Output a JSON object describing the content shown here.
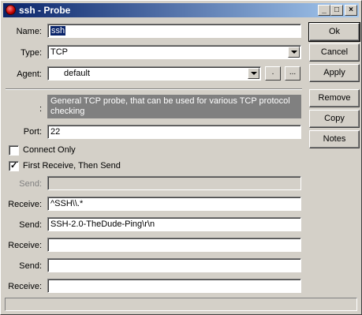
{
  "window": {
    "title": "ssh - Probe"
  },
  "titlebar": {
    "minimize": "_",
    "maximize": "□",
    "close": "×"
  },
  "form": {
    "name_label": "Name:",
    "name_value": "ssh",
    "type_label": "Type:",
    "type_value": "TCP",
    "agent_label": "Agent:",
    "agent_value": "default",
    "agent_btn1": ".",
    "agent_btn2": "...",
    "desc_label": ":",
    "description": "General TCP probe, that can be used for various TCP protocol checking",
    "port_label": "Port:",
    "port_value": "22",
    "connect_only_label": "Connect Only",
    "connect_only_checked": false,
    "first_receive_label": "First Receive, Then Send",
    "first_receive_checked": true,
    "rows": [
      {
        "label": "Send:",
        "value": "",
        "disabled": true
      },
      {
        "label": "Receive:",
        "value": "^SSH\\\\.*",
        "disabled": false
      },
      {
        "label": "Send:",
        "value": "SSH-2.0-TheDude-Ping\\r\\n",
        "disabled": false
      },
      {
        "label": "Receive:",
        "value": "",
        "disabled": false
      },
      {
        "label": "Send:",
        "value": "",
        "disabled": false
      },
      {
        "label": "Receive:",
        "value": "",
        "disabled": false
      }
    ]
  },
  "buttons": {
    "ok": "Ok",
    "cancel": "Cancel",
    "apply": "Apply",
    "remove": "Remove",
    "copy": "Copy",
    "notes": "Notes"
  },
  "icons": {
    "app": "probe-app-icon",
    "dropdown": "chevron-down-icon",
    "check": "checkmark-icon"
  },
  "colors": {
    "titlebar_start": "#0a246a",
    "titlebar_end": "#a6caf0",
    "face": "#d4d0c8",
    "desc_bg": "#808080"
  }
}
